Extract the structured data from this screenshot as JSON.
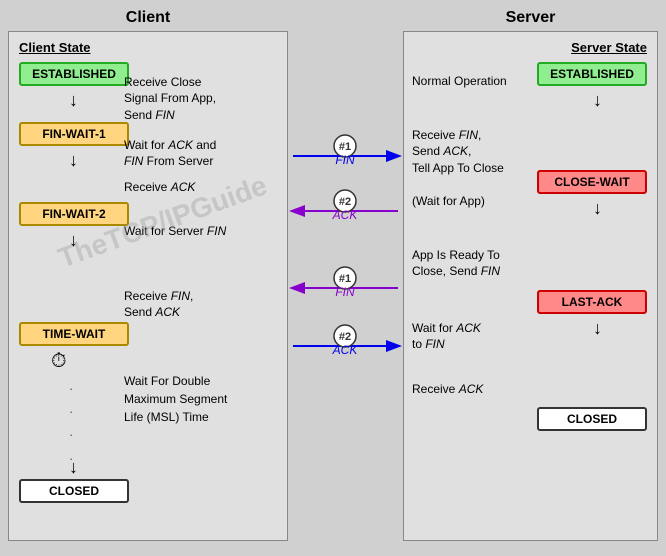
{
  "headers": {
    "client": "Client",
    "server": "Server"
  },
  "client": {
    "section_label": "Client State",
    "states": {
      "established": "ESTABLISHED",
      "finwait1": "FIN-WAIT-1",
      "finwait2": "FIN-WAIT-2",
      "timewait": "TIME-WAIT",
      "closed": "CLOSED"
    },
    "descriptions": {
      "send_fin": "Receive Close\nSignal From App,\nSend FIN",
      "wait_ack_fin": "Wait for ACK and\nFIN From Server",
      "receive_ack": "Receive ACK",
      "receive_fin_send_ack": "Receive FIN,\nSend ACK",
      "wait_msl": "Wait For Double\nMaximum Segment\nLife (MSL) Time"
    }
  },
  "server": {
    "section_label": "Server State",
    "states": {
      "established": "ESTABLISHED",
      "closewait": "CLOSE-WAIT",
      "lastack": "LAST-ACK",
      "closed": "CLOSED"
    },
    "descriptions": {
      "normal_op": "Normal Operation",
      "receive_fin": "Receive FIN,\nSend ACK,\nTell App To Close",
      "wait_for_app": "(Wait for App)",
      "app_ready": "App Is Ready To\nClose, Send FIN",
      "wait_ack_fin": "Wait for ACK\nto FIN",
      "receive_ack": "Receive ACK"
    }
  },
  "arrows": {
    "fin1_label": "FIN",
    "ack2_label": "ACK",
    "fin1_server_label": "FIN",
    "ack2_server_label": "ACK",
    "num1": "#1",
    "num2": "#2",
    "color_blue": "#0000ff",
    "color_purple": "#8800cc"
  },
  "watermark": "TheTCP/IPGuide"
}
